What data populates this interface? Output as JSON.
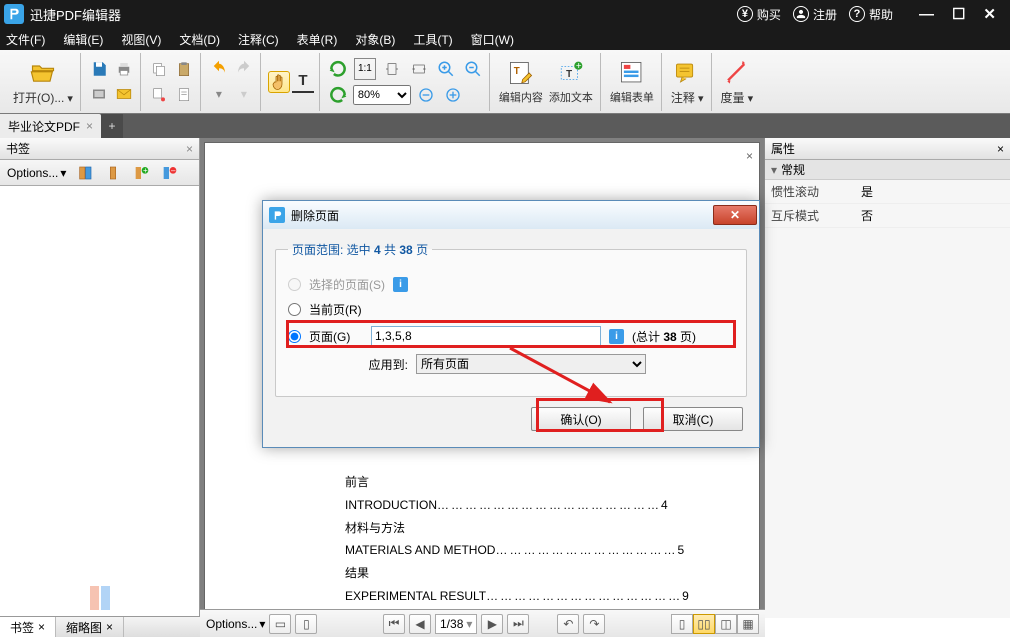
{
  "app": {
    "title": "迅捷PDF编辑器"
  },
  "titlebar": {
    "buy": "购买",
    "register": "注册",
    "help": "帮助"
  },
  "menu": {
    "file": "文件(F)",
    "edit": "编辑(E)",
    "view": "视图(V)",
    "document": "文档(D)",
    "comment": "注释(C)",
    "form": "表单(R)",
    "object": "对象(B)",
    "tool": "工具(T)",
    "window": "窗口(W)"
  },
  "toolbar": {
    "open": "打开(O)...",
    "zoom": "80%",
    "edit_content": "编辑内容",
    "add_text": "添加文本",
    "edit_form": "编辑表单",
    "annotate": "注释",
    "measure": "度量"
  },
  "document_tab": {
    "name": "毕业论文PDF"
  },
  "left_pane": {
    "title": "书签",
    "options": "Options..."
  },
  "right_pane": {
    "title": "属性",
    "section": "常规",
    "inertial_scroll": {
      "k": "惯性滚动",
      "v": "是"
    },
    "mutex_mode": {
      "k": "互斥模式",
      "v": "否"
    }
  },
  "bottom_tabs": {
    "bookmarks": "书签",
    "thumbnails": "缩略图"
  },
  "statusbar": {
    "options": "Options...",
    "page_current": "1",
    "page_total": "38"
  },
  "dialog": {
    "title": "删除页面",
    "range_legend_prefix": "页面范围: 选中 ",
    "range_selected": "4",
    "range_mid": " 共 ",
    "range_total": "38",
    "range_suffix": " 页",
    "opt_selected_pages": "选择的页面(S)",
    "opt_current_page": "当前页(R)",
    "opt_pages": "页面(G)",
    "pages_value": "1,3,5,8",
    "total_prefix": "(总计 ",
    "total_count": "38",
    "total_suffix": " 页)",
    "apply_to": "应用到:",
    "apply_value": "所有页面",
    "ok": "确认(O)",
    "cancel": "取消(C)"
  },
  "doc_content": {
    "l1": "前言",
    "l2a": "INTRODUCTION ",
    "l2b": "4",
    "l3": "材料与方法",
    "l4a": "MATERIALS AND METHOD ",
    "l4b": "5",
    "l5": "结果",
    "l6a": "EXPERIMENTAL  RESULT ",
    "l6b": "9"
  }
}
